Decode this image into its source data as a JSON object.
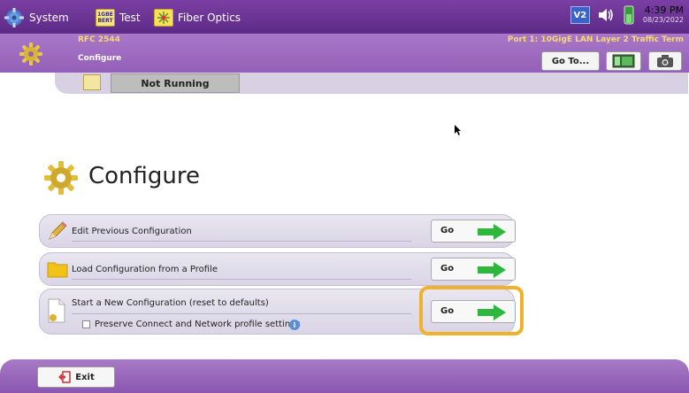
{
  "topbar": {
    "tabs": [
      {
        "label": "System",
        "icon": "gear-icon"
      },
      {
        "label": "Test",
        "icon": "bert-icon",
        "icon_text": "1GBE BERT"
      },
      {
        "label": "Fiber Optics",
        "icon": "fiber-optics-icon"
      }
    ],
    "status_badge": "V2",
    "time": "4:39 PM",
    "date": "08/23/2022"
  },
  "subheader": {
    "test_name": "RFC 2544",
    "section": "Configure",
    "port_info": "Port 1: 10GigE LAN Layer 2 Traffic Term",
    "goto_label": "Go To..."
  },
  "status": {
    "state": "Not Running"
  },
  "main": {
    "title": "Configure",
    "options": [
      {
        "label": "Edit Previous Configuration",
        "button": "Go"
      },
      {
        "label": "Load Configuration from a Profile",
        "button": "Go"
      },
      {
        "label": "Start a New Configuration (reset to defaults)",
        "button": "Go",
        "checkbox_label": "Preserve Connect and Network profile settings",
        "checkbox_checked": false
      }
    ]
  },
  "footer": {
    "exit_label": "Exit"
  },
  "colors": {
    "topbar": "#6a3595",
    "subheader": "#9e6bbf",
    "accent_yellow": "#f7d774",
    "highlight": "#f0b22b",
    "arrow_green": "#2db83d"
  }
}
